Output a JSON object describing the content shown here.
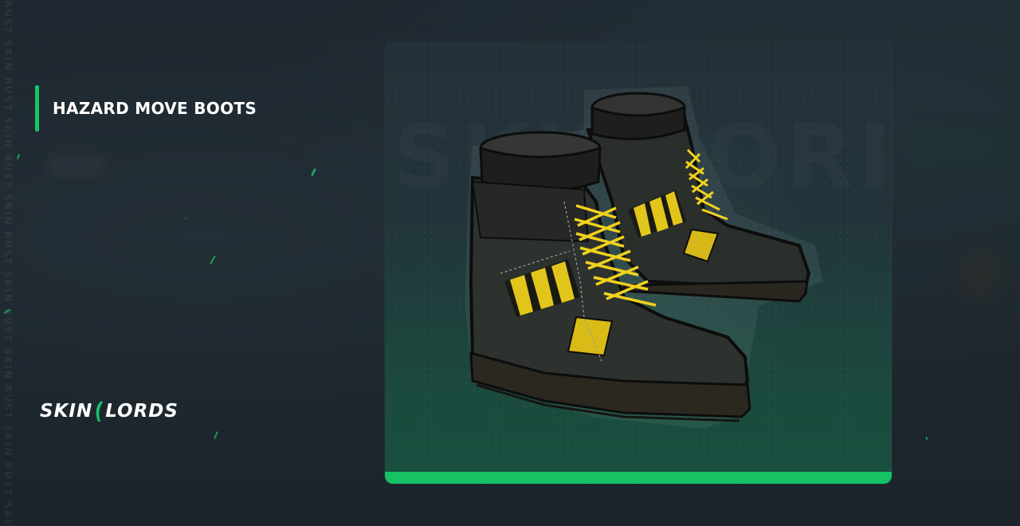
{
  "item": {
    "title": "HAZARD MOVE BOOTS",
    "image_alt": "Hazard Move Boots skin"
  },
  "brand": {
    "logo_left": "SKIN",
    "logo_right": "LORDS",
    "accent_color": "#16c36a"
  },
  "icons": {
    "title_accent": "vertical-accent-bar",
    "logo_mark": "sickle-mark"
  }
}
